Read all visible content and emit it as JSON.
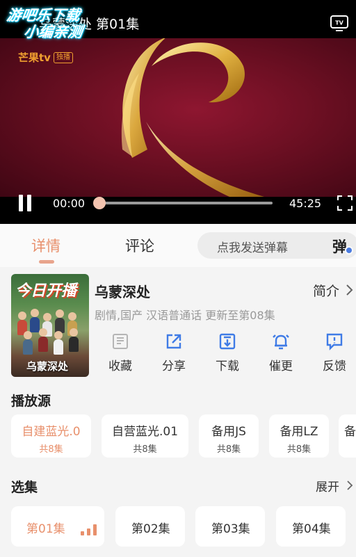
{
  "player": {
    "title": "乌蒙深处 第01集",
    "watermark_line1": "游吧乐下载",
    "watermark_line2": "小编亲测",
    "channel_logo": "芒果tv",
    "channel_badge": "独播",
    "time_current": "00:00",
    "time_total": "45:25",
    "progress": 0.0
  },
  "tabs": {
    "details": "详情",
    "comments": "评论",
    "danmaku_placeholder": "点我发送弹幕",
    "danmaku_icon": "弹"
  },
  "info": {
    "poster_banner": "今日开播",
    "poster_name": "乌蒙深处",
    "title": "乌蒙深处",
    "intro_label": "简介",
    "meta": "剧情,国产 汉语普通话 更新至第08集",
    "actions": [
      {
        "label": "收藏",
        "icon": "favorite-icon"
      },
      {
        "label": "分享",
        "icon": "share-icon"
      },
      {
        "label": "下载",
        "icon": "download-icon"
      },
      {
        "label": "催更",
        "icon": "bell-icon"
      },
      {
        "label": "反馈",
        "icon": "feedback-icon"
      }
    ]
  },
  "sources": {
    "title": "播放源",
    "items": [
      {
        "name": "自建蓝光.0",
        "count": "共8集",
        "active": true
      },
      {
        "name": "自营蓝光.01",
        "count": "共8集",
        "active": false
      },
      {
        "name": "备用JS",
        "count": "共8集",
        "active": false
      },
      {
        "name": "备用LZ",
        "count": "共8集",
        "active": false
      },
      {
        "name": "备",
        "count": "",
        "active": false
      }
    ]
  },
  "episodes": {
    "title": "选集",
    "expand_label": "展开",
    "items": [
      {
        "label": "第01集",
        "active": true
      },
      {
        "label": "第02集",
        "active": false
      },
      {
        "label": "第03集",
        "active": false
      },
      {
        "label": "第04集",
        "active": false
      }
    ]
  },
  "colors": {
    "accent": "#e8906c",
    "action_blue": "#3f7be6",
    "background": "#f4f4f4"
  }
}
